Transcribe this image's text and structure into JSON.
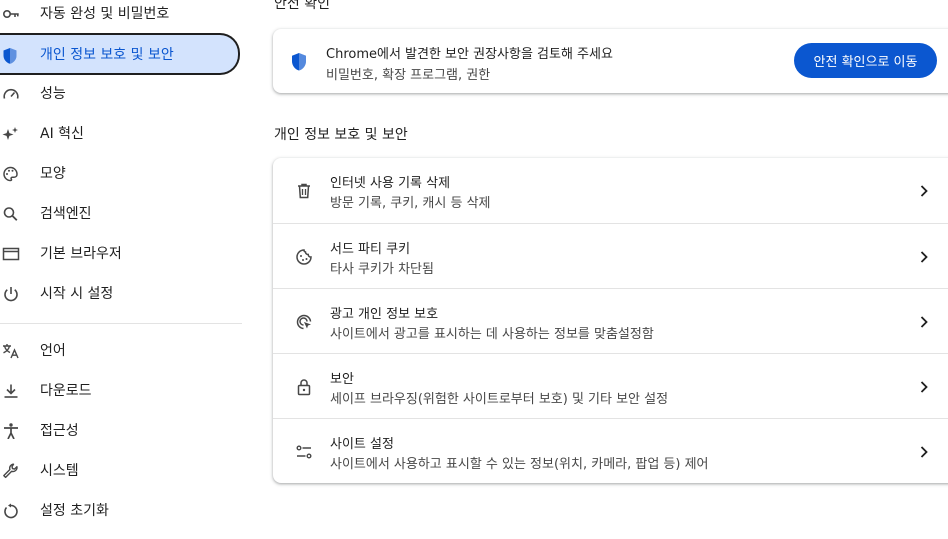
{
  "sidebar": {
    "items": [
      {
        "label": "자동 완성 및 비밀번호",
        "icon": "key-icon"
      },
      {
        "label": "개인 정보 보호 및 보안",
        "icon": "shield-icon",
        "active": true
      },
      {
        "label": "성능",
        "icon": "speedometer-icon"
      },
      {
        "label": "AI 혁신",
        "icon": "sparkle-icon"
      },
      {
        "label": "모양",
        "icon": "palette-icon"
      },
      {
        "label": "검색엔진",
        "icon": "search-icon"
      },
      {
        "label": "기본 브라우저",
        "icon": "browser-window-icon"
      },
      {
        "label": "시작 시 설정",
        "icon": "power-icon"
      },
      {
        "label": "언어",
        "icon": "translate-icon"
      },
      {
        "label": "다운로드",
        "icon": "download-icon"
      },
      {
        "label": "접근성",
        "icon": "accessibility-icon"
      },
      {
        "label": "시스템",
        "icon": "wrench-icon"
      },
      {
        "label": "설정 초기화",
        "icon": "reset-icon"
      }
    ]
  },
  "safety_check": {
    "section_title": "안전 확인",
    "title": "Chrome에서 발견한 보안 권장사항을 검토해 주세요",
    "subtitle": "비밀번호, 확장 프로그램, 권한",
    "button_label": "안전 확인으로 이동",
    "icon": "shield-icon"
  },
  "privacy": {
    "section_title": "개인 정보 보호 및 보안",
    "rows": [
      {
        "title": "인터넷 사용 기록 삭제",
        "subtitle": "방문 기록, 쿠키, 캐시 등 삭제",
        "icon": "trash-icon"
      },
      {
        "title": "서드 파티 쿠키",
        "subtitle": "타사 쿠키가 차단됨",
        "icon": "cookie-icon"
      },
      {
        "title": "광고 개인 정보 보호",
        "subtitle": "사이트에서 광고를 표시하는 데 사용하는 정보를 맞춤설정함",
        "icon": "ad-privacy-icon"
      },
      {
        "title": "보안",
        "subtitle": "세이프 브라우징(위험한 사이트로부터 보호) 및 기타 보안 설정",
        "icon": "lock-icon"
      },
      {
        "title": "사이트 설정",
        "subtitle": "사이트에서 사용하고 표시할 수 있는 정보(위치, 카메라, 팝업 등) 제어",
        "icon": "sliders-icon"
      }
    ]
  },
  "colors": {
    "accent": "#0b57d0",
    "active_bg": "#d3e3fd",
    "text": "#1f1f1f",
    "secondary_text": "#474747"
  }
}
